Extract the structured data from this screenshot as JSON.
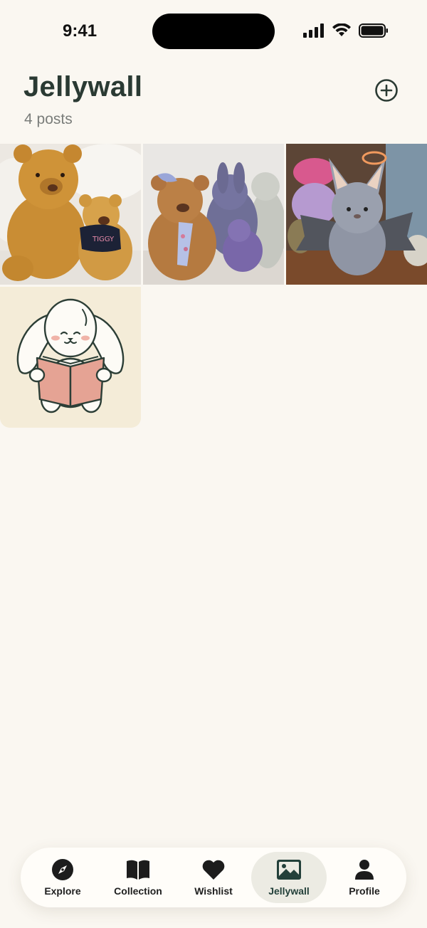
{
  "status_bar": {
    "time": "9:41"
  },
  "header": {
    "title": "Jellywall",
    "post_count": "4 posts",
    "add_icon": "plus-circle-icon"
  },
  "posts": [
    {
      "description": "plush-bears"
    },
    {
      "description": "plush-bear-and-bunnies"
    },
    {
      "description": "plush-bat"
    },
    {
      "description": "bunny-reading-illustration"
    }
  ],
  "tiles": {
    "shirt_text": "TIGGY"
  },
  "tabbar": {
    "active": "Jellywall",
    "tabs": [
      {
        "label": "Explore",
        "icon": "compass-icon"
      },
      {
        "label": "Collection",
        "icon": "book-icon"
      },
      {
        "label": "Wishlist",
        "icon": "heart-icon"
      },
      {
        "label": "Jellywall",
        "icon": "image-icon"
      },
      {
        "label": "Profile",
        "icon": "person-icon"
      }
    ]
  },
  "colors": {
    "background": "#faf7f1",
    "accent": "#23403a"
  }
}
